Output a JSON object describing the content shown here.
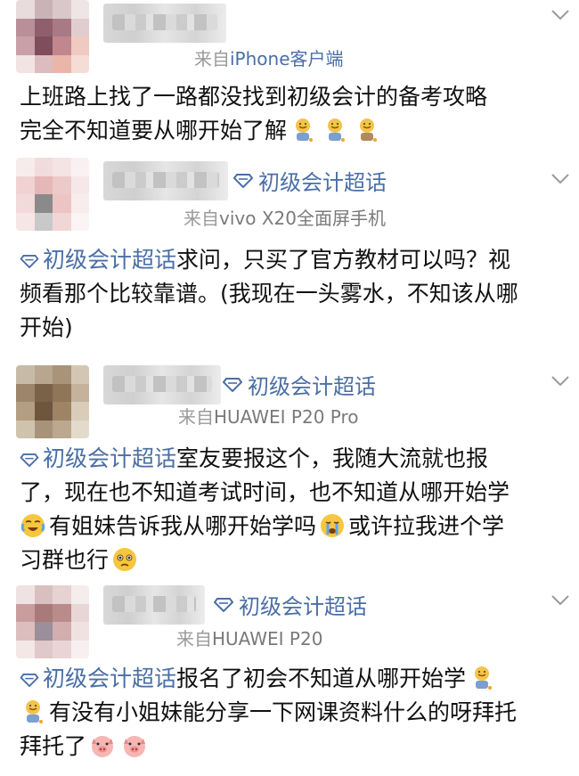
{
  "colors": {
    "link": "#4a6fa5",
    "text": "#111111",
    "meta": "#7a7a7a"
  },
  "posts": [
    {
      "topic": "",
      "device_prefix": "来自",
      "device": "iPhone客户端",
      "line1": "上班路上找了一路都没找到初级会计的备考攻略",
      "line2": "完全不知道要从哪开始了解",
      "emojis": [
        "sad-face-icon",
        "sad-face-icon",
        "sad-face-icon"
      ]
    },
    {
      "topic": "初级会计超话",
      "device_prefix": "来自",
      "device": "vivo X20全面屏手机",
      "body_topic": "初级会计超话",
      "line1": "求问，只买了官方教材可以吗？视",
      "line2": "频看那个比较靠谱。(我现在一头雾水，不知该从哪",
      "line3": "开始)"
    },
    {
      "topic": "初级会计超话",
      "device_prefix": "来自",
      "device": "HUAWEI P20 Pro",
      "body_topic": "初级会计超话",
      "line1": "室友要报这个，我随大流就也报",
      "line2": "了，现在也不知道考试时间，也不知道从哪开始学",
      "line3a": "有姐妹告诉我从哪开始学吗",
      "line3b": "或许拉我进个学",
      "line4": "习群也行"
    },
    {
      "topic": "初级会计超话",
      "device_prefix": "来自",
      "device": "HUAWEI P20",
      "body_topic": "初级会计超话",
      "line1": "报名了初会不知道从哪开始学",
      "line2": "有没有小姐妹能分享一下网课资料什么的呀拜托",
      "line3": "拜托了"
    }
  ]
}
